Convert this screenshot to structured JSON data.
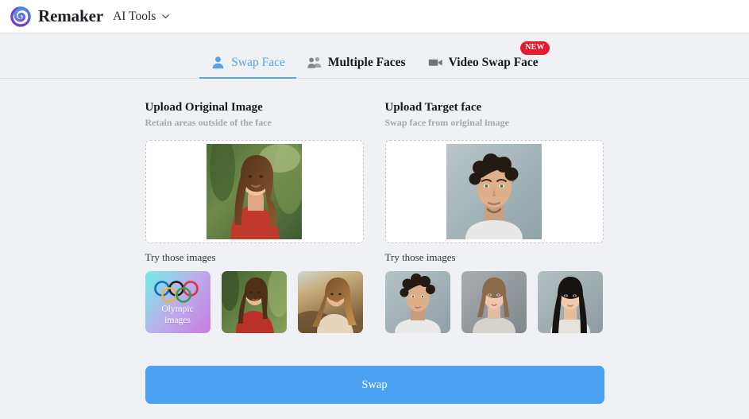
{
  "header": {
    "logo_icon": "remaker-spiral-logo",
    "brand": "Remaker",
    "menu_label": "AI Tools",
    "menu_chevron_icon": "chevron-down-icon"
  },
  "tabs": [
    {
      "label": "Swap Face",
      "icon": "person-icon",
      "active": true,
      "badge": ""
    },
    {
      "label": "Multiple Faces",
      "icon": "people-icon",
      "active": false,
      "badge": ""
    },
    {
      "label": "Video Swap Face",
      "icon": "video-camera-icon",
      "active": false,
      "badge": "NEW"
    }
  ],
  "panels": [
    {
      "title": "Upload Original Image",
      "subtitle": "Retain areas outside of the face",
      "preview_alt": "woman-in-red-top-jungle-background",
      "try_label": "Try those images",
      "thumbs": [
        {
          "alt": "olympic-rings-card",
          "caption_line1": "Olympic",
          "caption_line2": "images"
        },
        {
          "alt": "woman-red-top-portrait",
          "caption_line1": "",
          "caption_line2": ""
        },
        {
          "alt": "woman-beach-sunset-portrait",
          "caption_line1": "",
          "caption_line2": ""
        }
      ]
    },
    {
      "title": "Upload Target face",
      "subtitle": "Swap face from original image",
      "preview_alt": "curly-haired-man-portrait",
      "try_label": "Try those images",
      "thumbs": [
        {
          "alt": "curly-haired-man-portrait",
          "caption_line1": "",
          "caption_line2": ""
        },
        {
          "alt": "fair-haired-woman-portrait",
          "caption_line1": "",
          "caption_line2": ""
        },
        {
          "alt": "dark-haired-woman-portrait",
          "caption_line1": "",
          "caption_line2": ""
        }
      ]
    }
  ],
  "actions": {
    "swap_label": "Swap"
  },
  "colors": {
    "accent_blue": "#4ba1f2",
    "active_tab_blue": "#57a3e8",
    "badge_red": "#e8192c",
    "page_bg": "#f0f1f5",
    "header_bg": "#ffffff"
  }
}
